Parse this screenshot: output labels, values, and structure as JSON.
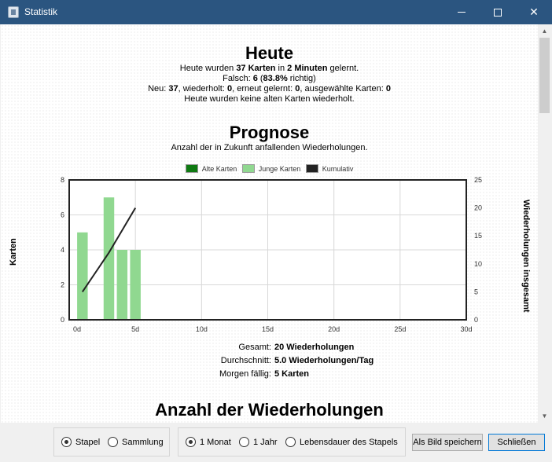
{
  "window": {
    "title": "Statistik"
  },
  "today": {
    "heading": "Heute",
    "line1": {
      "a": "Heute wurden ",
      "b": "37 Karten",
      "c": " in ",
      "d": "2 Minuten",
      "e": " gelernt."
    },
    "line2": {
      "a": "Falsch: ",
      "b": "6",
      "c": " (",
      "d": "83.8%",
      "e": " richtig)"
    },
    "line3": {
      "a": "Neu: ",
      "b": "37",
      "c": ", wiederholt: ",
      "d": "0",
      "e": ", erneut gelernt: ",
      "f": "0",
      "g": ", ausgewählte Karten: ",
      "h": "0"
    },
    "line4": "Heute wurden keine alten Karten wiederholt."
  },
  "forecast": {
    "heading": "Prognose",
    "subtitle": "Anzahl der in Zukunft anfallenden Wiederholungen.",
    "summary": [
      {
        "key": "Gesamt:",
        "value": "20 Wiederholungen"
      },
      {
        "key": "Durchschnitt:",
        "value": "5.0 Wiederholungen/Tag"
      },
      {
        "key": "Morgen fällig:",
        "value": "5 Karten"
      }
    ]
  },
  "next_heading": "Anzahl der Wiederholungen",
  "chart_data": {
    "type": "bar",
    "legend": [
      "Alte Karten",
      "Junge Karten",
      "Kumulativ"
    ],
    "colors": {
      "alte": "#0f7a12",
      "junge": "#90d890",
      "kumulativ": "#222222"
    },
    "ylabel": "Karten",
    "y2label": "Wiederholungen insgesamt",
    "xlim": [
      0,
      30
    ],
    "ylim": [
      0,
      8
    ],
    "y2lim": [
      0,
      25
    ],
    "xticks": [
      "0d",
      "5d",
      "10d",
      "15d",
      "20d",
      "25d",
      "30d"
    ],
    "yticks": [
      "0",
      "2",
      "4",
      "6",
      "8"
    ],
    "y2ticks": [
      "0",
      "5",
      "10",
      "15",
      "20",
      "25"
    ],
    "series": [
      {
        "name": "Alte Karten",
        "x": [],
        "values": []
      },
      {
        "name": "Junge Karten",
        "x": [
          1,
          3,
          4,
          5
        ],
        "values": [
          5,
          7,
          4,
          4
        ]
      },
      {
        "name": "Kumulativ",
        "x": [
          1,
          3,
          4,
          5
        ],
        "values": [
          5,
          12,
          16,
          20
        ]
      }
    ],
    "grid": true,
    "legend_position": "top"
  },
  "bottom": {
    "group1": [
      {
        "label": "Stapel",
        "selected": true
      },
      {
        "label": "Sammlung",
        "selected": false
      }
    ],
    "group2": [
      {
        "label": "1 Monat",
        "selected": true
      },
      {
        "label": "1 Jahr",
        "selected": false
      },
      {
        "label": "Lebensdauer des Stapels",
        "selected": false
      }
    ],
    "save_label": "Als Bild speichern",
    "close_label": "Schließen"
  }
}
